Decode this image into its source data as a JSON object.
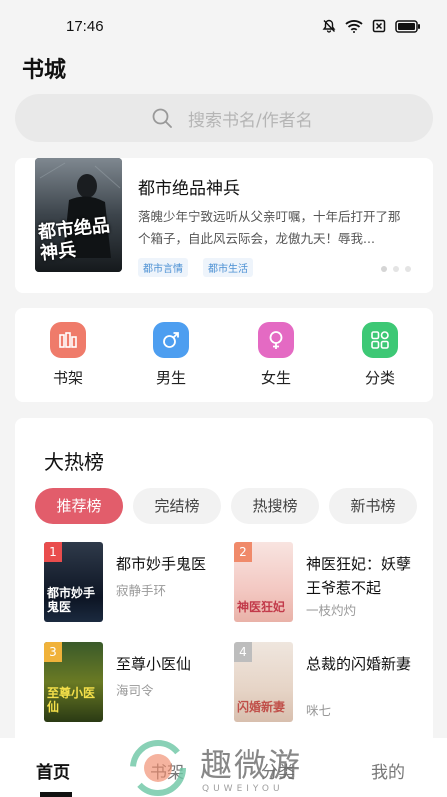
{
  "status": {
    "time": "17:46"
  },
  "page_title": "书城",
  "search": {
    "placeholder": "搜索书名/作者名"
  },
  "banner": {
    "cover_text": "都市绝品神兵",
    "title": "都市绝品神兵",
    "description": "落魄少年宁致远听从父亲叮嘱，十年后打开了那个箱子，自此风云际会，龙傲九天！辱我...",
    "tags": [
      "都市言情",
      "都市生活"
    ]
  },
  "nav": {
    "items": [
      {
        "label": "书架",
        "icon": "bookshelf-icon",
        "color": "#ef7b6a"
      },
      {
        "label": "男生",
        "icon": "male-icon",
        "color": "#4d9ef0"
      },
      {
        "label": "女生",
        "icon": "female-icon",
        "color": "#e46ac3"
      },
      {
        "label": "分类",
        "icon": "category-icon",
        "color": "#3dc875"
      }
    ]
  },
  "ranking": {
    "title": "大热榜",
    "tabs": [
      "推荐榜",
      "完结榜",
      "热搜榜",
      "新书榜"
    ],
    "books": [
      {
        "rank": "1",
        "name": "都市妙手鬼医",
        "author": "寂静手环",
        "cover_text": "都市妙手鬼医"
      },
      {
        "rank": "2",
        "name": "神医狂妃：妖孽王爷惹不起",
        "author": "一枝灼灼",
        "cover_text": "神医狂妃"
      },
      {
        "rank": "3",
        "name": "至尊小医仙",
        "author": "海司令",
        "cover_text": "至尊小医仙"
      },
      {
        "rank": "4",
        "name": "总裁的闪婚新妻",
        "author": "咪七",
        "cover_text": "闪婚新妻"
      }
    ]
  },
  "tabbar": {
    "items": [
      "首页",
      "书架",
      "分类",
      "我的"
    ]
  },
  "watermark": {
    "text": "趣微游",
    "sub": "QUWEIYOU"
  }
}
